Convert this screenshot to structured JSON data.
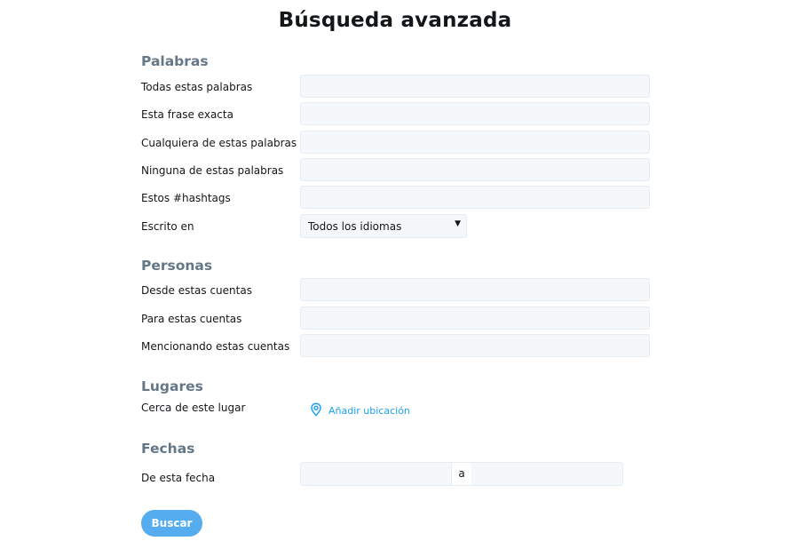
{
  "page": {
    "title": "Búsqueda avanzada"
  },
  "palabras": {
    "section_title": "Palabras",
    "all_words_label": "Todas estas palabras",
    "exact_phrase_label": "Esta frase exacta",
    "any_words_label": "Cualquiera de estas palabras",
    "none_words_label": "Ninguna de estas palabras",
    "hashtags_label": "Estos #hashtags",
    "language_label": "Escrito en",
    "language_selected": "Todos los idiomas"
  },
  "personas": {
    "section_title": "Personas",
    "from_label": "Desde estas cuentas",
    "to_label": "Para estas cuentas",
    "mentioning_label": "Mencionando estas cuentas"
  },
  "lugares": {
    "section_title": "Lugares",
    "near_label": "Cerca de este lugar",
    "add_location_label": "Añadir ubicación",
    "location_icon": "map-pin-icon"
  },
  "fechas": {
    "section_title": "Fechas",
    "date_label": "De esta fecha",
    "separator": "a"
  },
  "actions": {
    "search_label": "Buscar"
  },
  "colors": {
    "accent": "#1da1f2",
    "button": "#55acee",
    "section_title": "#657786",
    "input_bg": "#f5f8fa",
    "input_border": "#e6ecf0"
  }
}
